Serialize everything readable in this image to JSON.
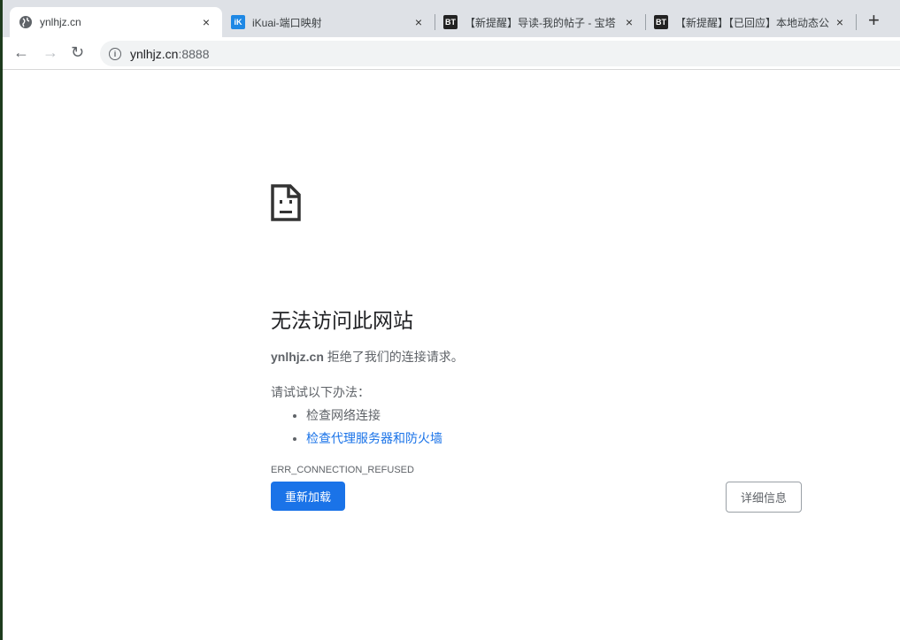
{
  "tabs": [
    {
      "title": "ynlhjz.cn",
      "icon": "globe-icon"
    },
    {
      "title": "iKuai-端口映射",
      "icon": "iK"
    },
    {
      "title": "【新提醒】导读-我的帖子 - 宝塔",
      "icon": "BT"
    },
    {
      "title": "【新提醒】【已回应】本地动态公",
      "icon": "BT"
    }
  ],
  "close": "×",
  "new_tab": "+",
  "toolbar": {
    "back": "←",
    "forward": "→",
    "reload": "↻",
    "url_host": "ynlhjz.cn",
    "url_port": ":8888",
    "info": "i"
  },
  "error": {
    "title": "无法访问此网站",
    "host": "ynlhjz.cn",
    "message": " 拒绝了我们的连接请求。",
    "suggest": "请试试以下办法：",
    "items": [
      "检查网络连接",
      "检查代理服务器和防火墙"
    ],
    "code": "ERR_CONNECTION_REFUSED",
    "reload": "重新加载",
    "details": "详细信息"
  }
}
